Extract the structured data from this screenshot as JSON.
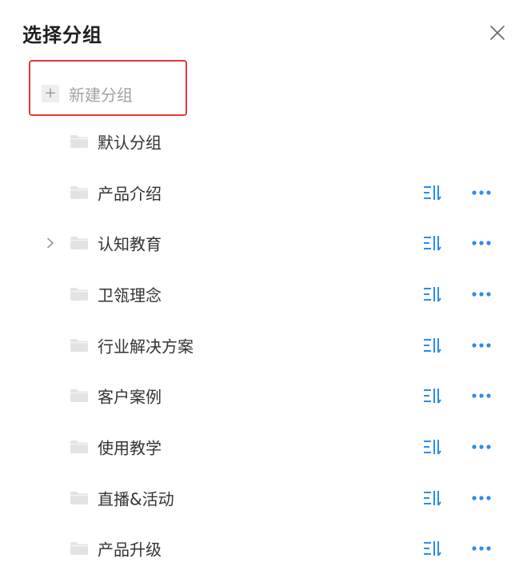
{
  "dialog": {
    "title": "选择分组",
    "close_icon": "close-icon"
  },
  "new_group": {
    "label": "新建分组",
    "icon": "plus-icon",
    "highlight_color": "#e53935"
  },
  "colors": {
    "accent": "#2a8cf0",
    "folder": "#e3e3e3",
    "text": "#333333",
    "muted": "#a3a3a3"
  },
  "groups": [
    {
      "label": "默认分组",
      "expandable": false,
      "actions": false
    },
    {
      "label": "产品介绍",
      "expandable": false,
      "actions": true
    },
    {
      "label": "认知教育",
      "expandable": true,
      "actions": true
    },
    {
      "label": "卫瓴理念",
      "expandable": false,
      "actions": true
    },
    {
      "label": "行业解决方案",
      "expandable": false,
      "actions": true
    },
    {
      "label": "客户案例",
      "expandable": false,
      "actions": true
    },
    {
      "label": "使用教学",
      "expandable": false,
      "actions": true
    },
    {
      "label": "直播&活动",
      "expandable": false,
      "actions": true
    },
    {
      "label": "产品升级",
      "expandable": false,
      "actions": true
    }
  ]
}
